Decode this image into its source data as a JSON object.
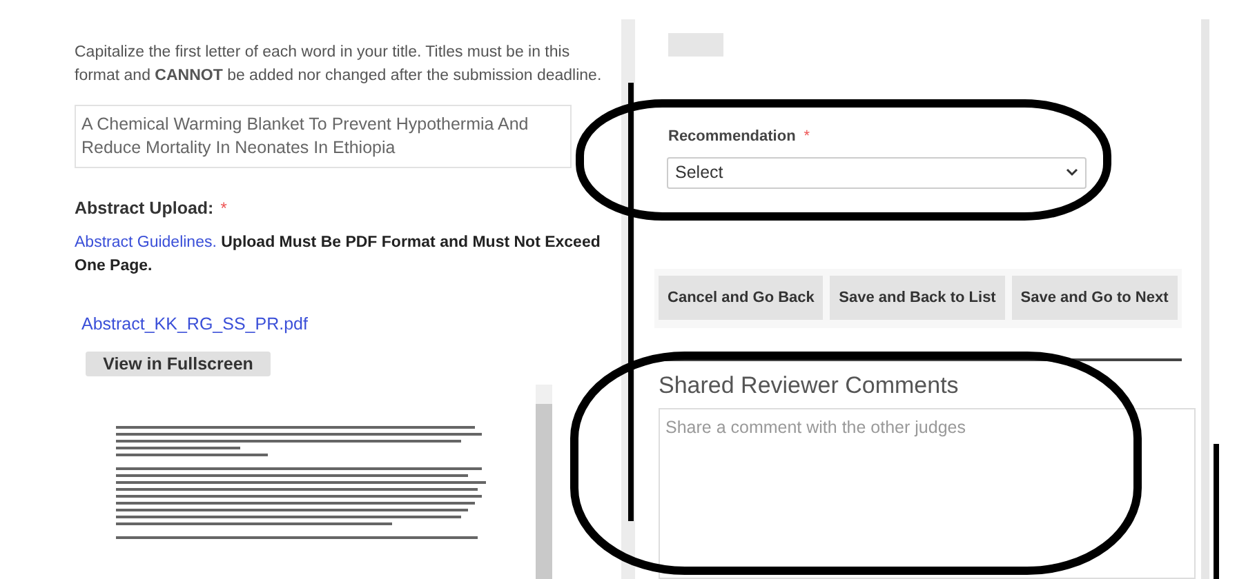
{
  "instructions": "Capitalize the first letter of each word in your title. Titles must be in this format and **CANNOT** be added nor changed after the submission deadline.",
  "title_field": {
    "value": "A Chemical Warming Blanket To Prevent Hypothermia And Reduce Mortality In Neonates In Ethiopia"
  },
  "abstract_upload": {
    "label": "Abstract Upload:",
    "required_mark": "*",
    "guidelines_link": "Abstract Guidelines.",
    "guidelines_note": "Upload Must Be PDF Format and Must Not Exceed One Page.",
    "file_link": "Abstract_KK_RG_SS_PR.pdf",
    "fullscreen_button": "View in Fullscreen"
  },
  "recommendation": {
    "label": "Recommendation",
    "required_mark": "*",
    "value": "Select"
  },
  "buttons": [
    "Cancel and Go Back",
    "Save and Back to List",
    "Save and Go to Next"
  ],
  "shared_comments": {
    "heading": "Shared Reviewer Comments",
    "placeholder": "Share a comment with the other judges"
  }
}
